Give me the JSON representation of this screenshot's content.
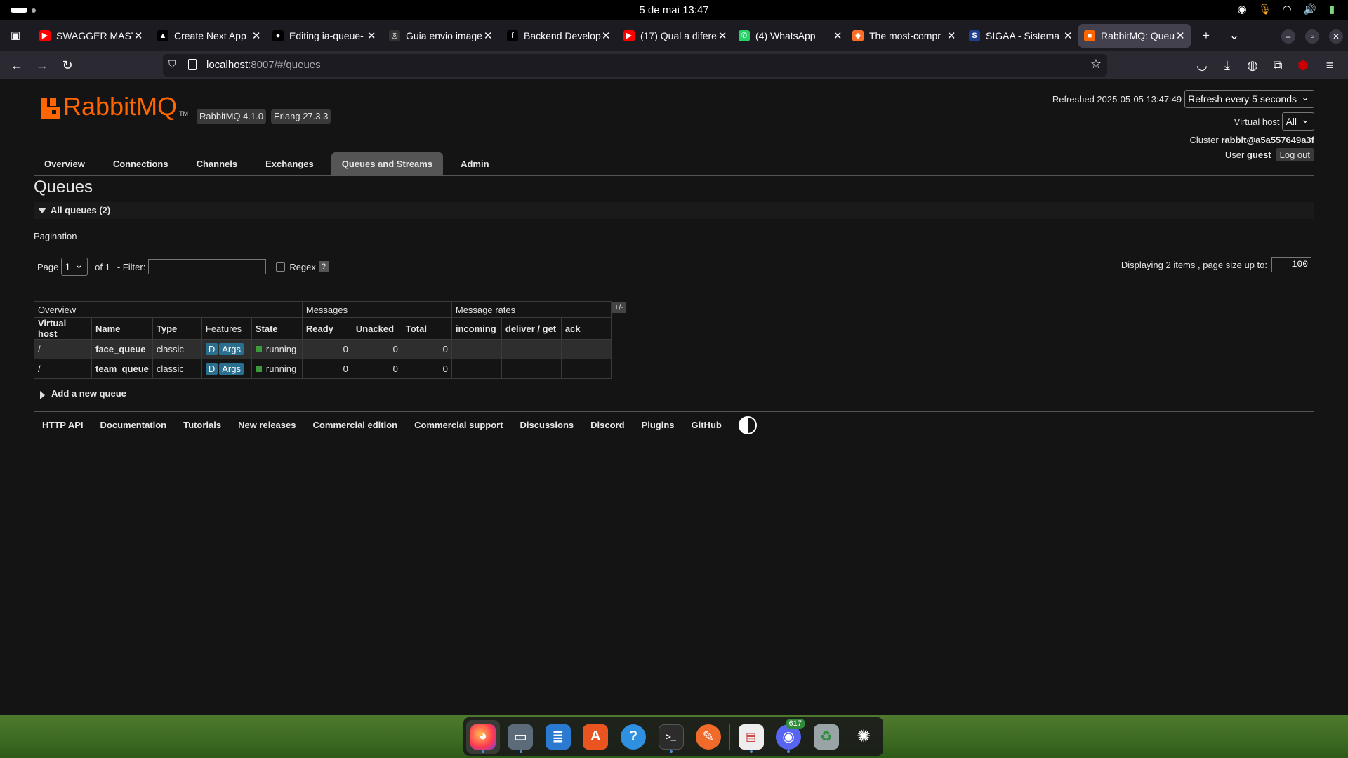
{
  "system": {
    "clock": "5 de mai  13:47",
    "tray_icons": [
      "discord-icon",
      "microphone-icon",
      "wifi-icon",
      "volume-icon",
      "battery-icon"
    ]
  },
  "browser": {
    "tabs": [
      {
        "title": "SWAGGER MASTI",
        "favicon_color": "#ff0000",
        "favicon_glyph": "▶"
      },
      {
        "title": "Create Next App",
        "favicon_color": "#000000",
        "favicon_glyph": "▲"
      },
      {
        "title": "Editing ia-queue-",
        "favicon_color": "#000000",
        "favicon_glyph": "●"
      },
      {
        "title": "Guia envio image",
        "favicon_color": "#333333",
        "favicon_glyph": "◎"
      },
      {
        "title": "Backend Develop",
        "favicon_color": "#000000",
        "favicon_glyph": "f"
      },
      {
        "title": "(17) Qual a difere",
        "favicon_color": "#ff0000",
        "favicon_glyph": "▶"
      },
      {
        "title": "(4) WhatsApp",
        "favicon_color": "#25d366",
        "favicon_glyph": "✆"
      },
      {
        "title": "The most-compr",
        "favicon_color": "#fc6d26",
        "favicon_glyph": "◆"
      },
      {
        "title": "SIGAA - Sistema I",
        "favicon_color": "#1f3f8f",
        "favicon_glyph": "S"
      },
      {
        "title": "RabbitMQ: Queu",
        "favicon_color": "#ff6600",
        "favicon_glyph": "■"
      }
    ],
    "active_tab_index": 9,
    "url_host": "localhost",
    "url_rest": ":8007/#/queues"
  },
  "rmq": {
    "logo_text": "RabbitMQ",
    "logo_tm": "TM",
    "version": "RabbitMQ 4.1.0",
    "erlang": "Erlang 27.3.3",
    "refreshed_label": "Refreshed 2025-05-05 13:47:49",
    "refresh_select": "Refresh every 5 seconds",
    "vhost_label": "Virtual host",
    "vhost_value": "All",
    "cluster_label": "Cluster",
    "cluster_value": "rabbit@a5a557649a3f",
    "user_label": "User",
    "user_value": "guest",
    "logout": "Log out",
    "nav": [
      {
        "label": "Overview"
      },
      {
        "label": "Connections"
      },
      {
        "label": "Channels"
      },
      {
        "label": "Exchanges"
      },
      {
        "label": "Queues and Streams",
        "active": true
      },
      {
        "label": "Admin"
      }
    ],
    "page_title": "Queues",
    "all_queues": "All queues (2)",
    "pagination_label": "Pagination",
    "page_label": "Page",
    "page_value": "1",
    "of_label": "of 1",
    "filter_label": "- Filter:",
    "regex_label": "Regex",
    "help_label": "?",
    "displaying": "Displaying 2 items , page size up to:",
    "page_size": "100",
    "table": {
      "groups": [
        "Overview",
        "Messages",
        "Message rates"
      ],
      "plus_minus": "+/-",
      "columns": [
        "Virtual host",
        "Name",
        "Type",
        "Features",
        "State",
        "Ready",
        "Unacked",
        "Total",
        "incoming",
        "deliver / get",
        "ack"
      ],
      "rows": [
        {
          "vhost": "/",
          "name": "face_queue",
          "type": "classic",
          "feat_d": "D",
          "feat_args": "Args",
          "state": "running",
          "ready": "0",
          "unacked": "0",
          "total": "0",
          "incoming": "",
          "deliver": "",
          "ack": ""
        },
        {
          "vhost": "/",
          "name": "team_queue",
          "type": "classic",
          "feat_d": "D",
          "feat_args": "Args",
          "state": "running",
          "ready": "0",
          "unacked": "0",
          "total": "0",
          "incoming": "",
          "deliver": "",
          "ack": ""
        }
      ]
    },
    "add_queue": "Add a new queue",
    "footer": [
      "HTTP API",
      "Documentation",
      "Tutorials",
      "New releases",
      "Commercial edition",
      "Commercial support",
      "Discussions",
      "Discord",
      "Plugins",
      "GitHub"
    ]
  },
  "dock": {
    "badge": "617",
    "apps": [
      "firefox-icon",
      "files-icon",
      "writer-icon",
      "app-center-icon",
      "help-icon",
      "terminal-icon",
      "text-editor-icon",
      "system-monitor-icon",
      "discord-dock-icon",
      "trash-icon",
      "show-apps-icon"
    ]
  }
}
